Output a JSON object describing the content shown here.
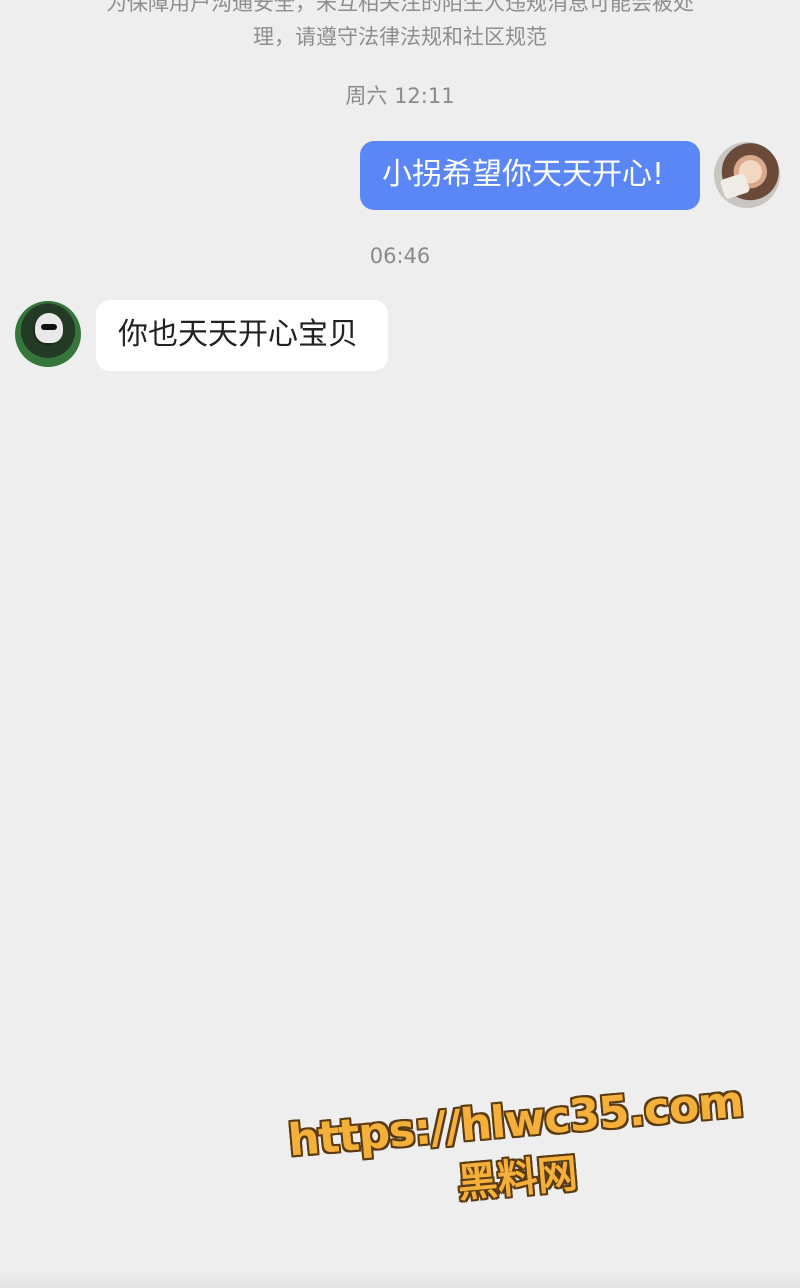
{
  "notice": {
    "line1": "为保障用户沟通安全，未互相关注的陌生人违规消息可能会被处",
    "line2": "理，请遵守法律法规和社区规范"
  },
  "timestamps": [
    "周六 12:11",
    "06:46"
  ],
  "messages": [
    {
      "direction": "outgoing",
      "text": "小拐希望你天天开心!"
    },
    {
      "direction": "incoming",
      "text": "你也天天开心宝贝"
    }
  ],
  "watermark": {
    "url": "https://hlwc35.com",
    "name": "黑料网"
  },
  "colors": {
    "background": "#eeeeee",
    "outgoing_bubble": "#5a87f5",
    "incoming_bubble": "#ffffff",
    "watermark": "#f4b03a"
  }
}
